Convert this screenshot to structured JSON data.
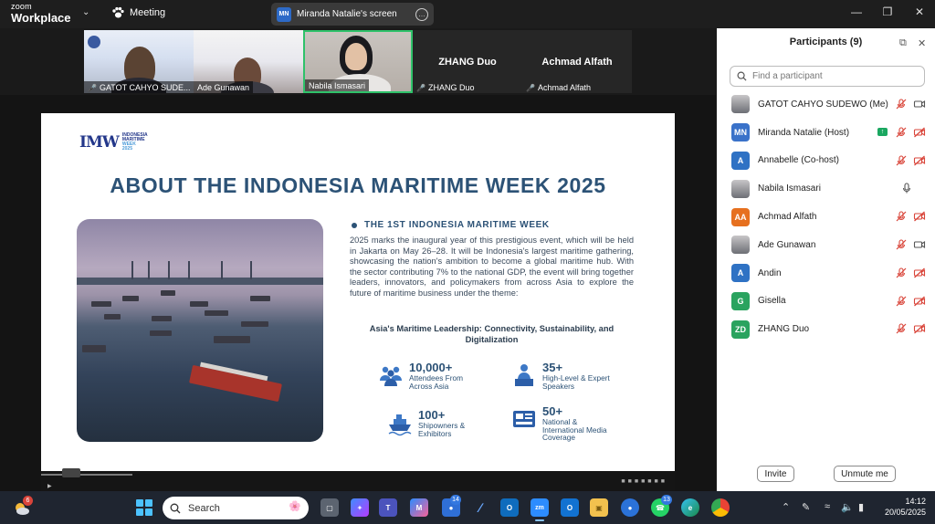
{
  "app": {
    "brand_line1": "zoom",
    "brand_line2": "Workplace",
    "meeting_label": "Meeting",
    "screen_owner_initials": "MN",
    "screen_label": "Miranda Natalie's screen",
    "more_icon": "ellipsis-icon",
    "window_controls": [
      "minimize-icon",
      "maximize-icon",
      "close-icon"
    ]
  },
  "videos": [
    {
      "name": "GATOT CAHYO SUDE...",
      "muted": true
    },
    {
      "name": "Ade Gunawan",
      "muted": false
    },
    {
      "name": "Nabila Ismasari",
      "muted": false,
      "active_speaker": true
    },
    {
      "name": "ZHANG Duo",
      "big_name": "ZHANG Duo",
      "muted": true
    },
    {
      "name": "Achmad Alfath",
      "big_name": "Achmad Alfath",
      "muted": true
    }
  ],
  "slide": {
    "logo_mark": "IMW",
    "logo_line1": "INDONESIA",
    "logo_line2": "MARITIME",
    "logo_line3": "WEEK",
    "logo_line4": "2025",
    "title": "ABOUT THE INDONESIA MARITIME WEEK 2025",
    "section_heading": "THE 1ST INDONESIA MARITIME WEEK",
    "paragraph": "2025 marks the inaugural year of this prestigious event, which will be held in Jakarta on May 26–28. It will be Indonesia's largest maritime gathering, showcasing the nation's ambition to become a global maritime hub. With the sector contributing 7% to the national GDP, the event will bring together leaders, innovators, and policymakers from across Asia to explore the future of maritime business under the theme:",
    "theme": "Asia's Maritime Leadership: Connectivity, Sustainability, and Digitalization",
    "stats": [
      {
        "icon": "people-icon",
        "number": "10,000+",
        "label": "Attendees From Across Asia"
      },
      {
        "icon": "speaker-icon",
        "number": "35+",
        "label": "High-Level & Expert Speakers"
      },
      {
        "icon": "ship-icon",
        "number": "100+",
        "label": "Shipowners & Exhibitors"
      },
      {
        "icon": "news-icon",
        "number": "50+",
        "label": "National & International Media Coverage"
      }
    ]
  },
  "panel": {
    "title": "Participants (9)",
    "search_placeholder": "Find a participant",
    "participants": [
      {
        "name": "GATOT CAHYO SUDEWO (Me)",
        "initials": "",
        "color": "",
        "photo": true,
        "mic": "muted",
        "video": "on"
      },
      {
        "name": "Miranda Natalie (Host)",
        "initials": "MN",
        "color": "#3a72c9",
        "photo": false,
        "sharing": true,
        "mic": "muted",
        "video": "off"
      },
      {
        "name": "Annabelle (Co-host)",
        "initials": "A",
        "color": "#2f72c4",
        "photo": false,
        "mic": "muted",
        "video": "off"
      },
      {
        "name": "Nabila Ismasari",
        "initials": "",
        "color": "",
        "photo": true,
        "mic": "on",
        "video": "on"
      },
      {
        "name": "Achmad Alfath",
        "initials": "AA",
        "color": "#e6701f",
        "photo": false,
        "mic": "muted",
        "video": "off"
      },
      {
        "name": "Ade Gunawan",
        "initials": "",
        "color": "",
        "photo": true,
        "mic": "muted",
        "video": "on"
      },
      {
        "name": "Andin",
        "initials": "A",
        "color": "#2f72c4",
        "photo": false,
        "mic": "muted",
        "video": "off"
      },
      {
        "name": "Gisella",
        "initials": "G",
        "color": "#2aa35f",
        "photo": false,
        "mic": "muted",
        "video": "off"
      },
      {
        "name": "ZHANG Duo",
        "initials": "ZD",
        "color": "#2aa35f",
        "photo": false,
        "mic": "muted",
        "video": "off"
      }
    ],
    "invite_label": "Invite",
    "unmute_label": "Unmute me"
  },
  "taskbar": {
    "weather_badge": "6",
    "search_label": "Search",
    "badge_teams": "14",
    "badge_whatsapp": "13",
    "time": "14:12",
    "date": "20/05/2025",
    "colors": {
      "accent": "#2d8cff",
      "active_speaker": "#2fc26a",
      "muted": "#e0453a"
    }
  }
}
